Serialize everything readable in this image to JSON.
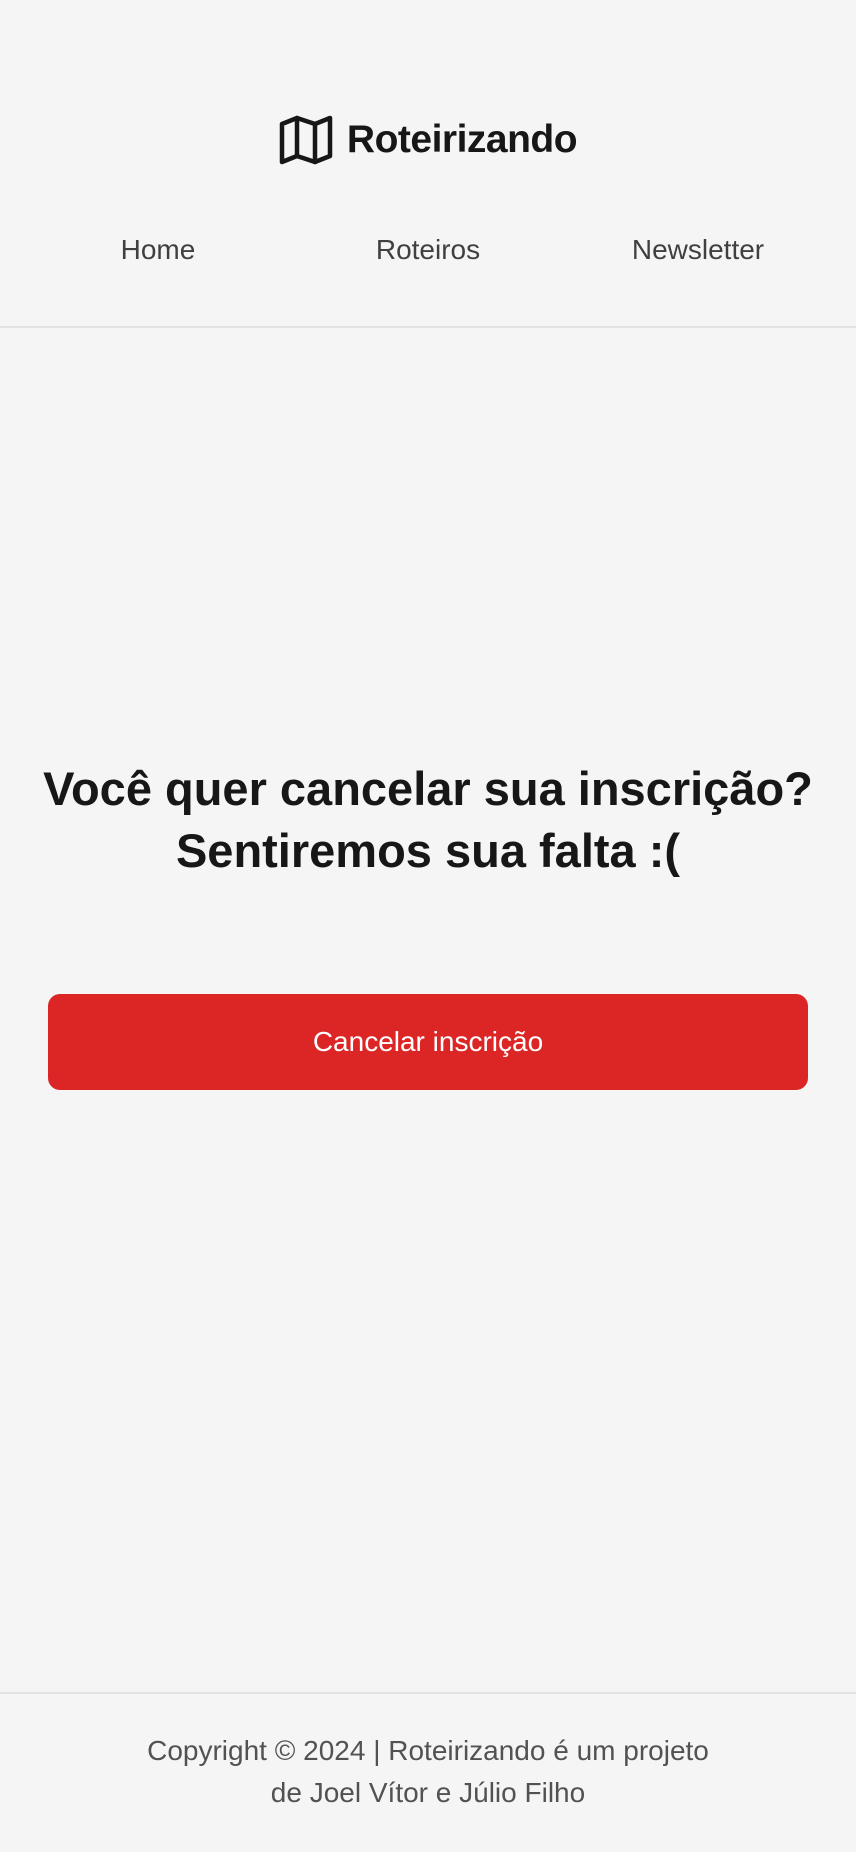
{
  "header": {
    "brand": {
      "name": "Roteirizando",
      "icon": "map-icon"
    },
    "nav": {
      "items": [
        {
          "label": "Home"
        },
        {
          "label": "Roteiros"
        },
        {
          "label": "Newsletter"
        }
      ]
    }
  },
  "main": {
    "title": "Você quer cancelar sua inscrição? Sentiremos sua falta :(",
    "cancel_button_label": "Cancelar inscrição",
    "button_color": "#dc2626"
  },
  "footer": {
    "text": "Copyright © 2024 | Roteirizando é um projeto de Joel Vítor e Júlio Filho"
  },
  "colors": {
    "background": "#f5f5f5",
    "text": "#171717",
    "accent": "#dc2626"
  }
}
